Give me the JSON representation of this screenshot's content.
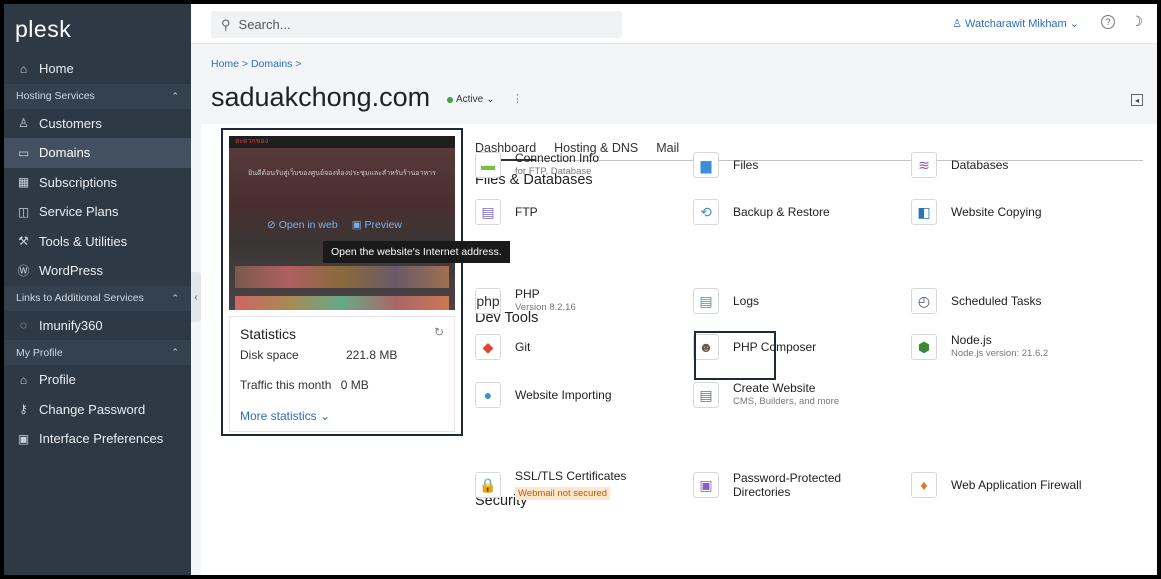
{
  "app": {
    "logo": "plesk"
  },
  "sidebar": {
    "items": [
      {
        "label": "Home",
        "icon": "home-icon",
        "glyph": "⌂"
      },
      {
        "group": "Hosting Services"
      },
      {
        "label": "Customers",
        "icon": "user-icon",
        "glyph": "♙"
      },
      {
        "label": "Domains",
        "icon": "monitor-icon",
        "glyph": "▭",
        "active": true
      },
      {
        "label": "Subscriptions",
        "icon": "grid-icon",
        "glyph": "▦"
      },
      {
        "label": "Service Plans",
        "icon": "columns-icon",
        "glyph": "◫"
      },
      {
        "label": "Tools & Utilities",
        "icon": "tools-icon",
        "glyph": "⚒"
      },
      {
        "label": "WordPress",
        "icon": "wordpress-icon",
        "glyph": "Ⓦ"
      },
      {
        "group": "Links to Additional Services"
      },
      {
        "label": "Imunify360",
        "icon": "imunify-icon",
        "glyph": "◌"
      },
      {
        "group": "My Profile"
      },
      {
        "label": "Profile",
        "icon": "profile-icon",
        "glyph": "⌂"
      },
      {
        "label": "Change Password",
        "icon": "key-icon",
        "glyph": "⚷"
      },
      {
        "label": "Interface Preferences",
        "icon": "preferences-icon",
        "glyph": "▣"
      }
    ]
  },
  "topbar": {
    "search_placeholder": "Search...",
    "user": "Watcharawit Mikham"
  },
  "header": {
    "breadcrumb": "Home > Domains >",
    "domain": "saduakchong.com",
    "status": "Active"
  },
  "preview": {
    "site_header": "สะดวกของ",
    "site_banner": "ยินดีต้อนรับสู่เว็บของศูนย์จองห้องประชุมและสำหรับร้านอาหาร",
    "open_in_web": "Open in web",
    "preview_label": "Preview",
    "tooltip": "Open the website's Internet address."
  },
  "statistics": {
    "title": "Statistics",
    "disk_label": "Disk space",
    "disk_value": "221.8 MB",
    "traffic_label": "Traffic this month",
    "traffic_value": "0 MB",
    "more": "More statistics"
  },
  "tabs": [
    "Dashboard",
    "Hosting & DNS",
    "Mail"
  ],
  "sections": {
    "files": "Files & Databases",
    "dev": "Dev Tools",
    "security": "Security"
  },
  "tools": {
    "connection_info": {
      "label": "Connection Info",
      "sub": "for FTP, Database",
      "icon": "plug-icon",
      "glyph": "▬",
      "color": "#7ac143"
    },
    "files": {
      "label": "Files",
      "icon": "folder-icon",
      "glyph": "▆",
      "color": "#3b8fd6"
    },
    "databases": {
      "label": "Databases",
      "icon": "database-icon",
      "glyph": "≋",
      "color": "#8a4fc1"
    },
    "ftp": {
      "label": "FTP",
      "icon": "ftp-icon",
      "glyph": "▤",
      "color": "#7b68c8"
    },
    "backup": {
      "label": "Backup & Restore",
      "icon": "backup-icon",
      "glyph": "⟲",
      "color": "#4b8bbd"
    },
    "website_copying": {
      "label": "Website Copying",
      "icon": "copy-icon",
      "glyph": "◧",
      "color": "#2a73b8"
    },
    "php": {
      "label": "PHP",
      "sub": "Version 8.2.16",
      "icon": "php-icon",
      "glyph": "php",
      "color": "#333"
    },
    "logs": {
      "label": "Logs",
      "icon": "logs-icon",
      "glyph": "▤",
      "color": "#3b8fd6"
    },
    "scheduled_tasks": {
      "label": "Scheduled Tasks",
      "icon": "clock-icon",
      "glyph": "◴",
      "color": "#3a4a9a"
    },
    "git": {
      "label": "Git",
      "icon": "git-icon",
      "glyph": "◆",
      "color": "#e0432b"
    },
    "php_composer": {
      "label": "PHP Composer",
      "icon": "composer-icon",
      "glyph": "☻",
      "color": "#6b5a4a"
    },
    "nodejs": {
      "label": "Node.js",
      "sub": "Node.js version: 21.6.2",
      "icon": "nodejs-icon",
      "glyph": "⬢",
      "color": "#3c873a"
    },
    "website_importing": {
      "label": "Website Importing",
      "icon": "import-icon",
      "glyph": "●",
      "color": "#3b8fd6"
    },
    "create_website": {
      "label": "Create Website",
      "sub": "CMS, Builders, and more",
      "icon": "create-website-icon",
      "glyph": "▤",
      "color": "#5a7a6a"
    },
    "ssl": {
      "label": "SSL/TLS Certificates",
      "warn": "Webmail not secured",
      "icon": "ssl-icon",
      "glyph": "🔒",
      "color": "#d98a00"
    },
    "password_dirs": {
      "label": "Password-Protected",
      "label2": "Directories",
      "icon": "folder-lock-icon",
      "glyph": "▣",
      "color": "#8a5fc1"
    },
    "waf": {
      "label": "Web Application Firewall",
      "icon": "firewall-icon",
      "glyph": "♦",
      "color": "#e8741a"
    }
  }
}
